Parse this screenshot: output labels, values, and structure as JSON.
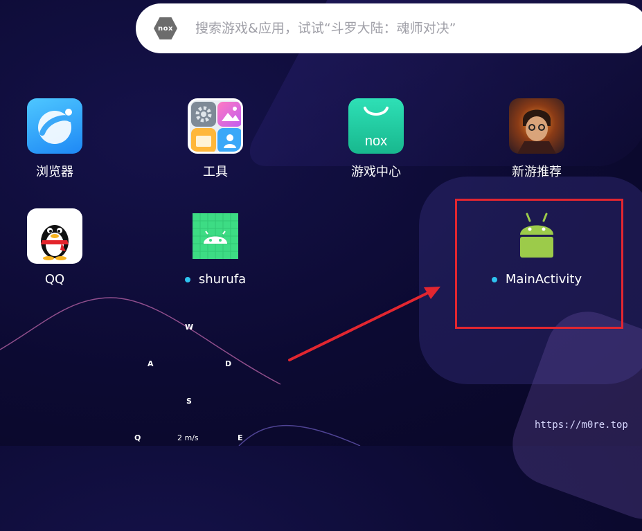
{
  "search": {
    "logo_text": "nox",
    "placeholder": "搜索游戏&应用，试试“斗罗大陆：魂师对决”"
  },
  "apps": [
    {
      "label": "浏览器",
      "icon": "browser-icon"
    },
    {
      "label": "工具",
      "icon": "tools-folder-icon"
    },
    {
      "label": "游戏中心",
      "icon": "game-center-icon"
    },
    {
      "label": "新游推荐",
      "icon": "new-game-recommend-icon"
    },
    {
      "label": "QQ",
      "icon": "qq-penguin-icon"
    },
    {
      "label": "shurufa",
      "icon": "android-icon",
      "new_dot": true
    },
    {
      "label": "MainActivity",
      "icon": "android-robot-icon",
      "new_dot": true
    }
  ],
  "gamepad": {
    "up": "W",
    "left": "A",
    "right": "D",
    "down": "S",
    "skill_q": "Q",
    "skill_e": "E",
    "speed": "2 m/s"
  },
  "watermark": "https://m0re.top",
  "colors": {
    "highlight": "#e22630",
    "arrow": "#e22630",
    "dot": "#2ec3f0"
  }
}
